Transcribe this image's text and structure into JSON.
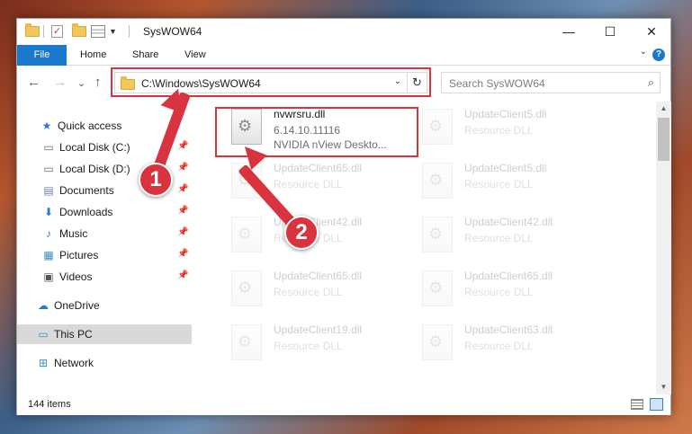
{
  "window": {
    "title": "SysWOW64",
    "minimize_glyph": "—",
    "maximize_glyph": "☐",
    "close_glyph": "✕"
  },
  "quick_access_toolbar": {
    "check_glyph": "✓",
    "dropdown_glyph": "▼"
  },
  "ribbon": {
    "tabs": [
      "File",
      "Home",
      "Share",
      "View"
    ],
    "expand_glyph": "⌄",
    "help_glyph": "?"
  },
  "navigation": {
    "back_glyph": "←",
    "forward_glyph": "→",
    "recent_glyph": "⌄",
    "up_glyph": "↑"
  },
  "address_bar": {
    "path": "C:\\Windows\\SysWOW64",
    "dropdown_glyph": "⌄",
    "refresh_glyph": "↻"
  },
  "search": {
    "placeholder": "Search SysWOW64",
    "icon_glyph": "⌕"
  },
  "nav_pane": {
    "pin_glyph": "📌",
    "items": [
      {
        "label": "Quick access",
        "icon": "star-icon",
        "glyph": "★",
        "color": "#2a79d1",
        "pinned": false
      },
      {
        "label": "Local Disk (C:)",
        "icon": "drive-icon",
        "glyph": "▭",
        "color": "#6a6a6a",
        "pinned": true
      },
      {
        "label": "Local Disk (D:)",
        "icon": "drive-icon",
        "glyph": "▭",
        "color": "#6a6a6a",
        "pinned": true
      },
      {
        "label": "Documents",
        "icon": "documents-icon",
        "glyph": "▤",
        "color": "#6a86a8",
        "pinned": true
      },
      {
        "label": "Downloads",
        "icon": "download-icon",
        "glyph": "⬇",
        "color": "#2a79d1",
        "pinned": true
      },
      {
        "label": "Music",
        "icon": "music-icon",
        "glyph": "♪",
        "color": "#2a79d1",
        "pinned": true
      },
      {
        "label": "Pictures",
        "icon": "pictures-icon",
        "glyph": "▦",
        "color": "#3c8fc6",
        "pinned": true
      },
      {
        "label": "Videos",
        "icon": "video-icon",
        "glyph": "▣",
        "color": "#555555",
        "pinned": true
      },
      {
        "label": "OneDrive",
        "icon": "cloud-icon",
        "glyph": "☁",
        "color": "#2a79d1",
        "pinned": false
      },
      {
        "label": "This PC",
        "icon": "computer-icon",
        "glyph": "▭",
        "color": "#3c8fc6",
        "pinned": false,
        "selected": true
      },
      {
        "label": "Network",
        "icon": "network-icon",
        "glyph": "⊞",
        "color": "#3c8fc6",
        "pinned": false
      }
    ]
  },
  "files": {
    "highlighted": {
      "name": "nvwrsru.dll",
      "version": "6.14.10.11116",
      "description": "NVIDIA nView Deskto..."
    },
    "background_tiles": [
      {
        "name": "UpdateClient5.dll",
        "type": "Resource DLL"
      },
      {
        "name": "UpdateClient65.dll",
        "type": "Resource DLL"
      },
      {
        "name": "UpdateClient5.dll",
        "type": "Resource DLL"
      },
      {
        "name": "UpdateClient42.dll",
        "type": "Resource DLL"
      },
      {
        "name": "UpdateClient42.dll",
        "type": "Resource DLL"
      },
      {
        "name": "UpdateClient65.dll",
        "type": "Resource DLL"
      },
      {
        "name": "UpdateClient65.dll",
        "type": "Resource DLL"
      },
      {
        "name": "UpdateClient19.dll",
        "type": "Resource DLL"
      },
      {
        "name": "UpdateClient63.dll",
        "type": "Resource DLL"
      }
    ]
  },
  "scrollbar": {
    "up_glyph": "▲",
    "down_glyph": "▼"
  },
  "status_bar": {
    "item_count": "144 items"
  },
  "annotations": {
    "step1": "1",
    "step2": "2"
  }
}
